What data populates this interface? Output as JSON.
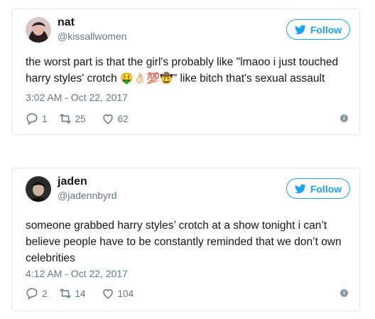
{
  "tweets": [
    {
      "name": "nat",
      "handle": "@kissallwomen",
      "follow_label": "Follow",
      "text_before": "the worst part is that the girl's probably like \"lmaoo i just touched harry styles' crotch ",
      "emojis": "🤑👌🏻💯🤠",
      "text_after": "\" like bitch that's sexual assault",
      "time": "3:02 AM - Oct 22, 2017",
      "replies": "1",
      "retweets": "25",
      "likes": "62",
      "avatar_colors": [
        "#3a2a2a",
        "#c98b87"
      ]
    },
    {
      "name": "jaden",
      "handle": "@jadennbyrd",
      "follow_label": "Follow",
      "text": "someone grabbed harry styles’ crotch at a show tonight i can’t believe people have to be constantly reminded that we don’t own celebrities",
      "time": "4:12 AM - Oct 22, 2017",
      "replies": "2",
      "retweets": "14",
      "likes": "104",
      "avatar_colors": [
        "#1b1b1b",
        "#b9a690"
      ]
    }
  ],
  "colors": {
    "twitter_blue": "#1da1f2",
    "secondary_text": "#657786",
    "border": "#e1e8ed"
  }
}
